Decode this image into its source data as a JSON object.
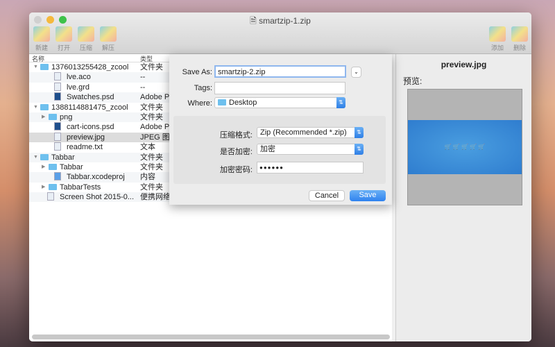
{
  "window": {
    "title": "smartzip-1.zip"
  },
  "toolbar": {
    "left": [
      {
        "label": "新建",
        "icon": "new-archive-icon"
      },
      {
        "label": "打开",
        "icon": "open-archive-icon"
      },
      {
        "label": "压缩",
        "icon": "compress-icon"
      },
      {
        "label": "解压",
        "icon": "extract-icon"
      }
    ],
    "right": [
      {
        "label": "添加",
        "icon": "add-icon"
      },
      {
        "label": "删除",
        "icon": "delete-icon"
      }
    ]
  },
  "list": {
    "columns": [
      "名称",
      "类型"
    ],
    "rows": [
      {
        "name": "1376013255428_zcool",
        "type": "文件夹",
        "level": 0,
        "kind": "folder",
        "tri": "open"
      },
      {
        "name": "lve.aco",
        "type": "--",
        "level": 2,
        "kind": "file"
      },
      {
        "name": "lve.grd",
        "type": "--",
        "level": 2,
        "kind": "file"
      },
      {
        "name": "Swatches.psd",
        "type": "Adobe Pl",
        "level": 2,
        "kind": "ps"
      },
      {
        "name": "1388114881475_zcool",
        "type": "文件夹",
        "level": 0,
        "kind": "folder",
        "tri": "open"
      },
      {
        "name": "png",
        "type": "文件夹",
        "level": 1,
        "kind": "folder",
        "tri": "closed"
      },
      {
        "name": "cart-icons.psd",
        "type": "Adobe Pl",
        "level": 2,
        "kind": "ps"
      },
      {
        "name": "preview.jpg",
        "type": "JPEG 图修",
        "level": 2,
        "kind": "file",
        "selected": true
      },
      {
        "name": "readme.txt",
        "type": "文本",
        "level": 2,
        "kind": "file"
      },
      {
        "name": "Tabbar",
        "type": "文件夹",
        "level": 0,
        "kind": "folder",
        "tri": "open"
      },
      {
        "name": "Tabbar",
        "type": "文件夹",
        "level": 1,
        "kind": "folder",
        "tri": "closed"
      },
      {
        "name": "Tabbar.xcodeproj",
        "type": "内容",
        "level": 2,
        "kind": "xc"
      },
      {
        "name": "TabbarTests",
        "type": "文件夹",
        "level": 1,
        "kind": "folder",
        "tri": "closed"
      },
      {
        "name": "Screen Shot 2015-0...",
        "type": "便携网络图",
        "level": 1,
        "kind": "file"
      }
    ]
  },
  "preview": {
    "filename": "preview.jpg",
    "label": "预览:"
  },
  "dialog": {
    "save_as_label": "Save As:",
    "save_as_value": "smartzip-2.zip",
    "tags_label": "Tags:",
    "tags_value": "",
    "where_label": "Where:",
    "where_value": "Desktop",
    "format_label": "压缩格式:",
    "format_value": "Zip (Recommended *.zip)",
    "encrypt_label": "是否加密:",
    "encrypt_value": "加密",
    "password_label": "加密密码:",
    "password_value": "●●●●●●",
    "cancel": "Cancel",
    "save": "Save"
  }
}
